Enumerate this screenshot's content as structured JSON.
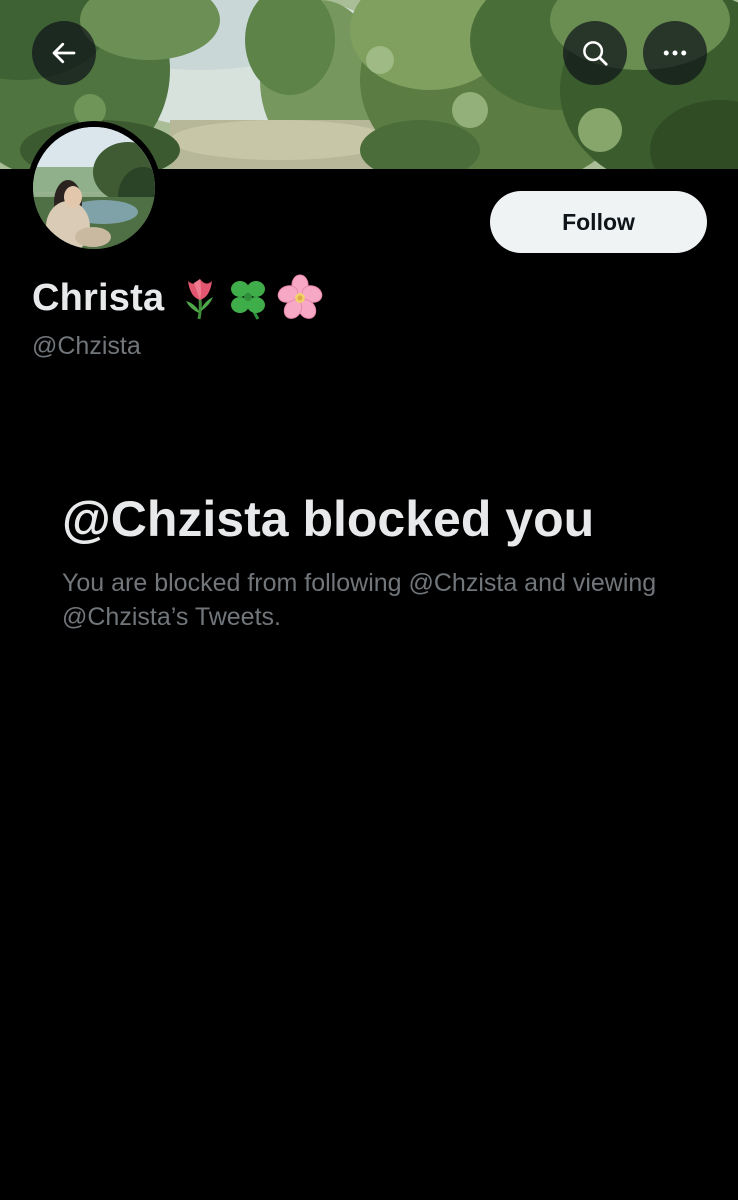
{
  "header": {
    "back_icon": "arrow-left-icon",
    "search_icon": "search-icon",
    "more_icon": "more-horizontal-icon"
  },
  "profile": {
    "display_name": "Christa",
    "emojis": [
      "tulip-emoji",
      "four-leaf-clover-emoji",
      "cherry-blossom-emoji"
    ],
    "handle": "@Chzista",
    "follow_label": "Follow"
  },
  "blocked": {
    "title": "@Chzista blocked you",
    "description": "You are blocked from following @Chzista and viewing @Chzista’s Tweets."
  },
  "colors": {
    "background": "#000000",
    "primary_text": "#e7e9ea",
    "secondary_text": "#71767b",
    "follow_button_bg": "#eff3f4",
    "follow_button_text": "#0f1419"
  }
}
